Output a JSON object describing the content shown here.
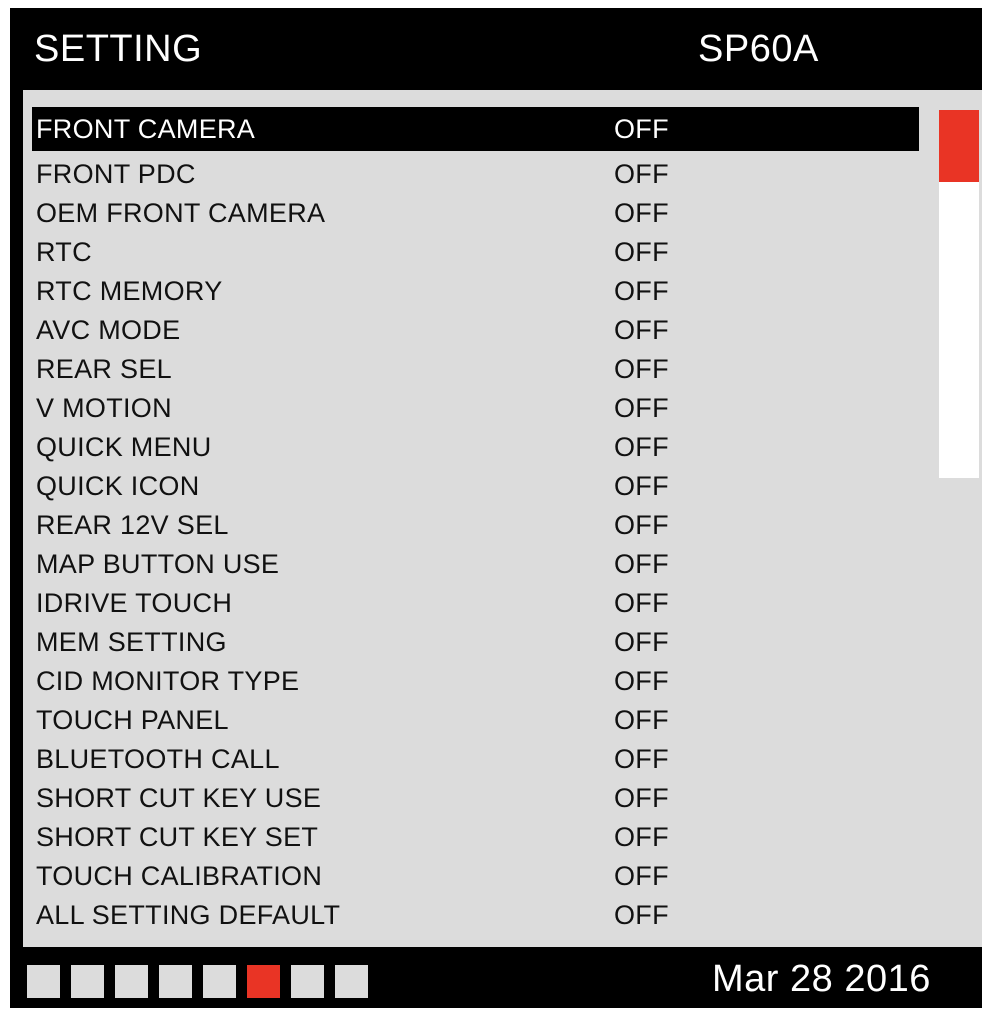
{
  "header": {
    "title": "SETTING",
    "model": "SP60A"
  },
  "settings": [
    {
      "label": "FRONT CAMERA",
      "value": "OFF"
    },
    {
      "label": "FRONT PDC",
      "value": "OFF"
    },
    {
      "label": "OEM FRONT CAMERA",
      "value": "OFF"
    },
    {
      "label": "RTC",
      "value": "OFF"
    },
    {
      "label": "RTC MEMORY",
      "value": "OFF"
    },
    {
      "label": "AVC MODE",
      "value": "OFF"
    },
    {
      "label": "REAR SEL",
      "value": "OFF"
    },
    {
      "label": "V MOTION",
      "value": "OFF"
    },
    {
      "label": "QUICK MENU",
      "value": "OFF"
    },
    {
      "label": "QUICK ICON",
      "value": "OFF"
    },
    {
      "label": "REAR 12V SEL",
      "value": "OFF"
    },
    {
      "label": "MAP BUTTON USE",
      "value": "OFF"
    },
    {
      "label": "IDRIVE TOUCH",
      "value": "OFF"
    },
    {
      "label": "MEM SETTING",
      "value": "OFF"
    },
    {
      "label": "CID MONITOR TYPE",
      "value": "OFF"
    },
    {
      "label": "TOUCH PANEL",
      "value": "OFF"
    },
    {
      "label": "BLUETOOTH CALL",
      "value": "OFF"
    },
    {
      "label": "SHORT CUT KEY USE",
      "value": "OFF"
    },
    {
      "label": "SHORT CUT KEY SET",
      "value": "OFF"
    },
    {
      "label": "TOUCH CALIBRATION",
      "value": "OFF"
    },
    {
      "label": "ALL SETTING DEFAULT",
      "value": "OFF"
    }
  ],
  "selected_index": 0,
  "pager": {
    "count": 8,
    "active_index": 5
  },
  "footer": {
    "date": "Mar 28 2016"
  },
  "colors": {
    "accent": "#e93425",
    "panel": "#dcdcdc",
    "background": "#000000"
  }
}
